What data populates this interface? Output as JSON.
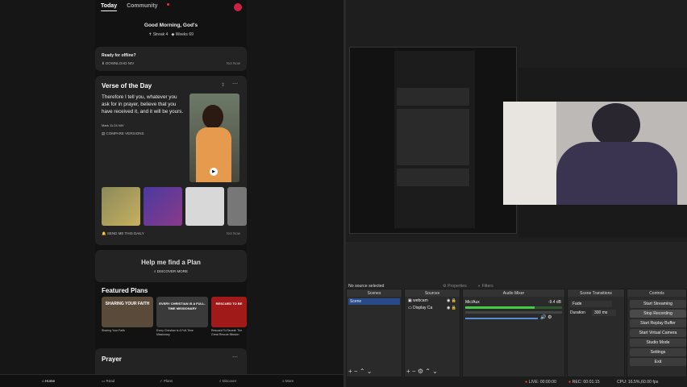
{
  "app": {
    "tabs": [
      "Today",
      "Community"
    ],
    "greeting": "Good Morning, God's",
    "streak": "Streak 4",
    "weeks": "Weeks 69",
    "offline": {
      "title": "Ready for offline?",
      "action": "DOWNLOAD NIV",
      "dismiss": "Not Now"
    },
    "votd": {
      "title": "Verse of the Day",
      "text": "Therefore I tell you, whatever you ask for in prayer, believe that you have received it, and it will be yours.",
      "ref": "Mark 11:24 NIV",
      "compare": "COMPARE VERSIONS",
      "send": "SEND ME THIS DAILY",
      "notnow": "Not Now"
    },
    "plan": {
      "title": "Help me find a Plan",
      "discover": "DISCOVER MORE"
    },
    "featured": {
      "title": "Featured Plans",
      "items": [
        {
          "art": "SHARING YOUR FAITH",
          "caption": "Sharing Your Faith"
        },
        {
          "art": "EVERY CHRISTIAN IS A FULL-TIME MISSIONARY",
          "caption": "Every Christian Is A Full-Time Missionary"
        },
        {
          "art": "RESCUED TO BE",
          "caption": "Rescued To Reveal: The Great Rescue Mission"
        }
      ]
    },
    "prayer": "Prayer",
    "nav": [
      "Home",
      "Read",
      "Plans",
      "Discover",
      "More"
    ]
  },
  "obs": {
    "no_source": "No source selected",
    "properties": "Properties",
    "filters": "Filters",
    "docks": {
      "scenes": "Scenes",
      "sources": "Sources",
      "mixer": "Audio Mixer",
      "transitions": "Scene Transitions",
      "controls": "Controls"
    },
    "scene": "Scene",
    "sources": [
      "webcam",
      "Display Ca"
    ],
    "mixer": {
      "channel": "Mic/Aux",
      "db": "-9.4 dB",
      "level": 0.72
    },
    "transition": "Fade",
    "duration_label": "Duration",
    "duration": "300 ms",
    "controls": [
      "Start Streaming",
      "Stop Recording",
      "Start Replay Buffer",
      "Start Virtual Camera",
      "Studio Mode",
      "Settings",
      "Exit"
    ],
    "status": {
      "live": "LIVE: 00:00:00",
      "rec": "REC: 00:01:15",
      "cpu": "CPU: 16.5%,60.00 fps"
    }
  }
}
